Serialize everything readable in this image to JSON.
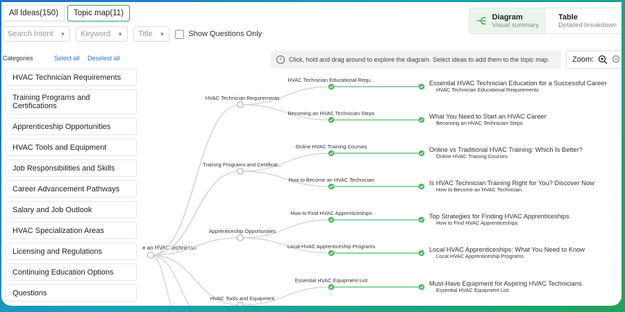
{
  "tabs": [
    {
      "label": "All Ideas(150)"
    },
    {
      "label": "Topic map(11)"
    }
  ],
  "filters": {
    "search_intent": "Search Intent",
    "keyword": "Keyword",
    "title": "Title",
    "show_questions": "Show Questions Only"
  },
  "view": {
    "diagram_title": "Diagram",
    "diagram_sub": "Visual summary",
    "table_title": "Table",
    "table_sub": "Detailed breakdown"
  },
  "categories": {
    "heading": "Categories",
    "select_all": "Select all",
    "deselect_all": "Deselect all",
    "items": [
      "HVAC Technician Requirements",
      "Training Programs and Certifications",
      "Apprenticeship Opportunities",
      "HVAC Tools and Equipment",
      "Job Responsibilities and Skills",
      "Career Advancement Pathways",
      "Salary and Job Outlook",
      "HVAC Specialization Areas",
      "Licensing and Regulations",
      "Continuing Education Options",
      "Questions"
    ]
  },
  "hint": "Click, hold and drag around to explore the diagram. Select ideas to add them to the topic map.",
  "zoom_label": "Zoom:",
  "map": {
    "root": "e an HVAC technician",
    "branches": [
      {
        "label": "HVAC Technician Requirements",
        "children": [
          {
            "label": "HVAC Technician Educational Requ...",
            "title": "Essential HVAC Technician Education for a Successful Career",
            "sub": "HVAC Technician Educational Requirements"
          },
          {
            "label": "Becoming an HVAC Technician Steps",
            "title": "What You Need to Start an HVAC Career",
            "sub": "Becoming an HVAC Technician Steps"
          }
        ]
      },
      {
        "label": "Training Programs and Certificat...",
        "children": [
          {
            "label": "Online HVAC Training Courses",
            "title": "Online vs Traditional HVAC Training: Which Is Better?",
            "sub": "Online HVAC Training Courses"
          },
          {
            "label": "How to Become an HVAC Technician",
            "title": "Is HVAC Technician Training Right for You? Discover Now",
            "sub": "How to Become an HVAC Technician"
          }
        ]
      },
      {
        "label": "Apprenticeship Opportunities",
        "children": [
          {
            "label": "How to Find HVAC Apprenticeships",
            "title": "Top Strategies for Finding HVAC Apprenticeships",
            "sub": "How to Find HVAC Apprenticeships"
          },
          {
            "label": "Local HVAC Apprenticeship Programs",
            "title": "Local HVAC Apprenticeships: What You Need to Know",
            "sub": "Local HVAC Apprenticeship Programs"
          }
        ]
      },
      {
        "label": "HVAC Tools and Equipment",
        "children": [
          {
            "label": "Essential HVAC Equipment List",
            "title": "Must-Have Equipment for Aspiring HVAC Technicians",
            "sub": "Essential HVAC Equipment List"
          }
        ]
      }
    ]
  },
  "colors": {
    "accent": "#2f9e4f",
    "node_green": "#4cb868",
    "link_green": "#7fcf92",
    "link_gray": "#d6d6d6"
  }
}
